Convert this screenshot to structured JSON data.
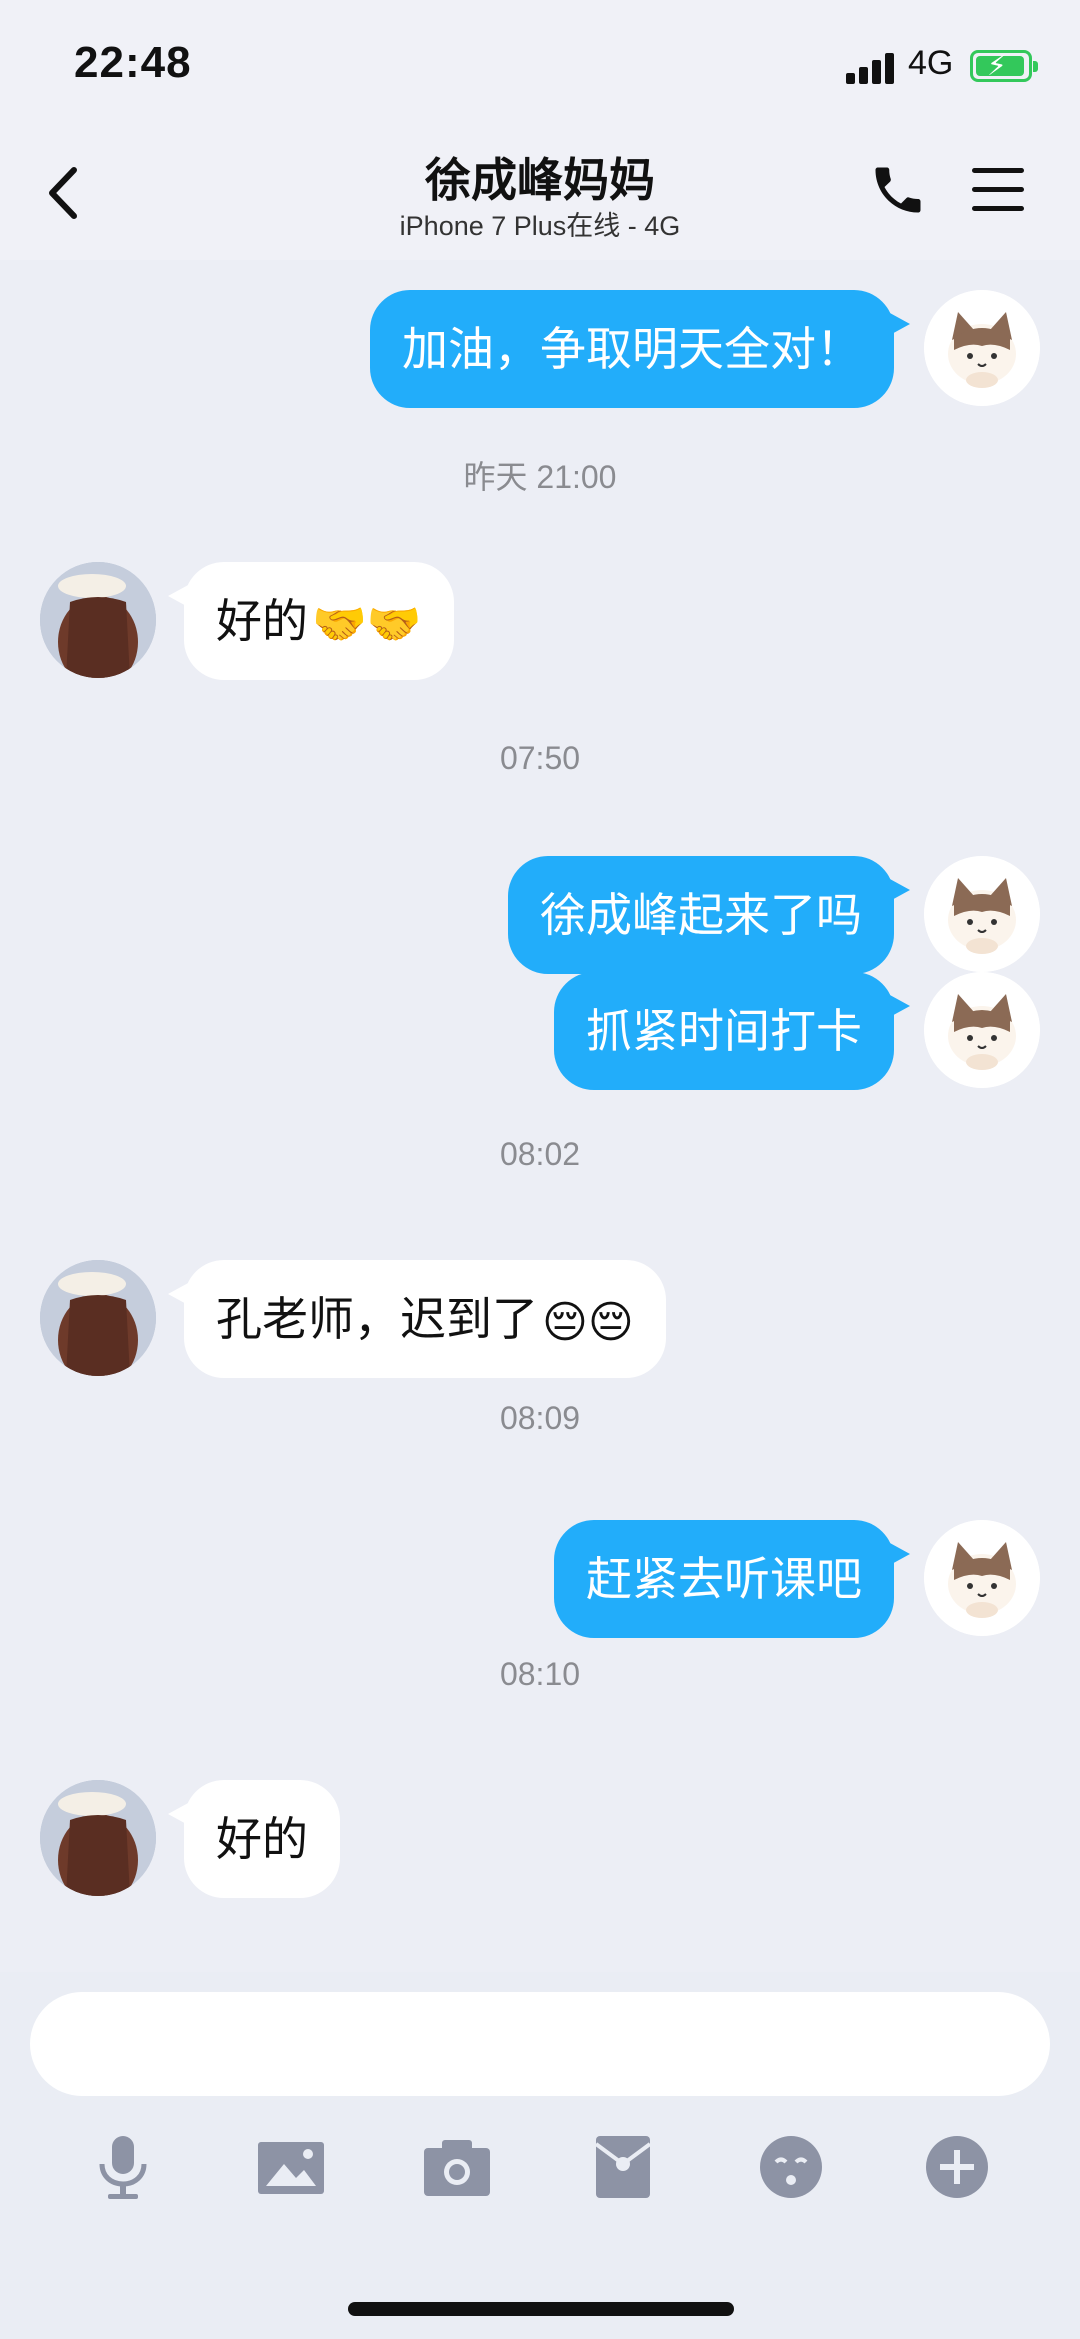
{
  "status_bar": {
    "time": "22:48",
    "network": "4G",
    "battery_state": "charging",
    "battery_color": "#33c85b"
  },
  "header": {
    "back_icon": "chevron-left-icon",
    "contact_name": "徐成峰妈妈",
    "contact_status": "iPhone 7 Plus在线 - 4G",
    "call_icon": "phone-icon",
    "menu_icon": "menu-icon"
  },
  "colors": {
    "outgoing_bubble": "#22adfa",
    "incoming_bubble": "#ffffff",
    "background": "#eceef5"
  },
  "messages": [
    {
      "type": "out",
      "text": "加油，争取明天全对！"
    },
    {
      "type": "time",
      "text": "昨天 21:00"
    },
    {
      "type": "in",
      "text": "好的",
      "emoji": "🤝🤝"
    },
    {
      "type": "time",
      "text": "07:50"
    },
    {
      "type": "out",
      "text": "徐成峰起来了吗"
    },
    {
      "type": "out",
      "text": "抓紧时间打卡"
    },
    {
      "type": "time",
      "text": "08:02"
    },
    {
      "type": "in",
      "text": "孔老师，迟到了",
      "emoji": "😔😔"
    },
    {
      "type": "time",
      "text": "08:09"
    },
    {
      "type": "out",
      "text": "赶紧去听课吧"
    },
    {
      "type": "time",
      "text": "08:10"
    },
    {
      "type": "in",
      "text": "好的"
    }
  ],
  "input": {
    "placeholder": ""
  },
  "toolbar": [
    "microphone-icon",
    "image-icon",
    "camera-icon",
    "red-packet-icon",
    "emoji-icon",
    "plus-icon"
  ]
}
